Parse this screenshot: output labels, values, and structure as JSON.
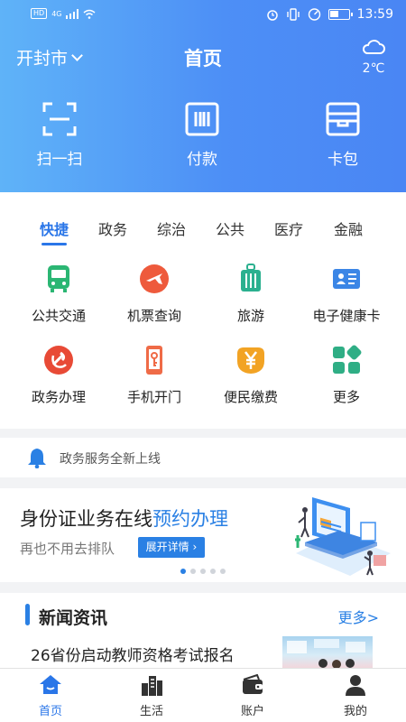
{
  "status_bar": {
    "hd": "HD",
    "network": "4G",
    "time": "13:59"
  },
  "header": {
    "city": "开封市",
    "title": "首页",
    "weather": {
      "icon": "cloud-icon",
      "temp": "2℃"
    }
  },
  "quick_actions": [
    {
      "label": "扫一扫",
      "icon": "scan-icon"
    },
    {
      "label": "付款",
      "icon": "payment-icon"
    },
    {
      "label": "卡包",
      "icon": "card-wallet-icon"
    }
  ],
  "tabs": [
    "快捷",
    "政务",
    "综治",
    "公共",
    "医疗",
    "金融"
  ],
  "services": [
    {
      "label": "公共交通",
      "icon": "bus-icon",
      "color": "#2bb673"
    },
    {
      "label": "机票查询",
      "icon": "airplane-icon",
      "color": "#ee5a3c"
    },
    {
      "label": "旅游",
      "icon": "luggage-icon",
      "color": "#2bb08f"
    },
    {
      "label": "电子健康卡",
      "icon": "health-card-icon",
      "color": "#3b86e6"
    },
    {
      "label": "政务办理",
      "icon": "party-emblem-icon",
      "color": "#e84a36"
    },
    {
      "label": "手机开门",
      "icon": "phone-key-icon",
      "color": "#ef6b47"
    },
    {
      "label": "便民缴费",
      "icon": "yuan-payment-icon",
      "color": "#f2a324"
    },
    {
      "label": "更多",
      "icon": "more-grid-icon",
      "color": "#2fae85"
    }
  ],
  "notice": {
    "text": "政务服务全新上线",
    "icon": "bell-icon"
  },
  "banner": {
    "title_plain": "身份证业务在线",
    "title_highlight": "预约办理",
    "subtitle": "再也不用去排队",
    "button": "展开详情",
    "page_count": 5,
    "active_page": 1
  },
  "news": {
    "title": "新闻资讯",
    "more": "更多>",
    "items": [
      {
        "title": "26省份启动教师资格考试报名"
      }
    ]
  },
  "bottom_nav": [
    {
      "label": "首页",
      "icon": "home-icon",
      "active": true
    },
    {
      "label": "生活",
      "icon": "city-buildings-icon",
      "active": false
    },
    {
      "label": "账户",
      "icon": "wallet-icon",
      "active": false
    },
    {
      "label": "我的",
      "icon": "user-icon",
      "active": false
    }
  ],
  "colors": {
    "accent": "#2a76e8",
    "header_start": "#5fb3f8",
    "header_end": "#4a86f4"
  }
}
